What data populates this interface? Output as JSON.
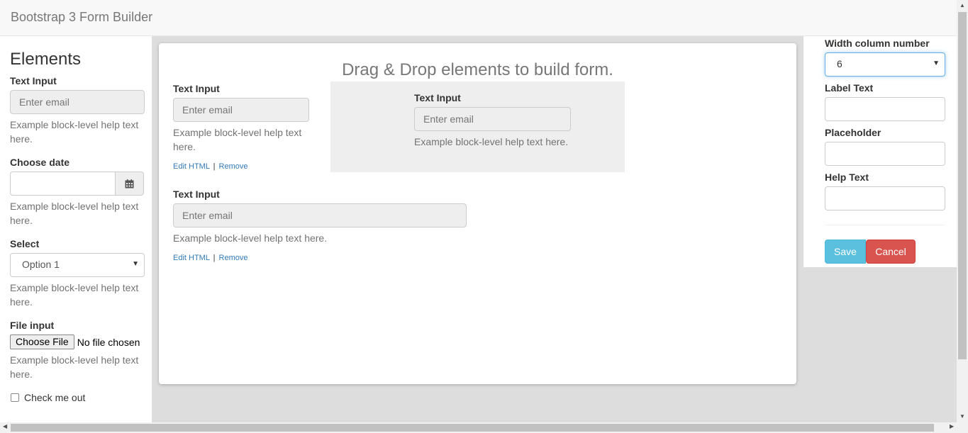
{
  "app": {
    "title": "Bootstrap 3 Form Builder"
  },
  "sidebar": {
    "heading": "Elements",
    "text_input": {
      "label": "Text Input",
      "placeholder": "Enter email",
      "help": "Example block-level help text here."
    },
    "date": {
      "label": "Choose date",
      "help": "Example block-level help text here.",
      "icon": "calendar-icon"
    },
    "select": {
      "label": "Select",
      "value": "Option 1",
      "help": "Example block-level help text here."
    },
    "file": {
      "label": "File input",
      "button": "Choose File",
      "status": "No file chosen",
      "help": "Example block-level help text here."
    },
    "checkbox": {
      "label": "Check me out"
    }
  },
  "canvas": {
    "title": "Drag & Drop elements to build form.",
    "fields": [
      {
        "label": "Text Input",
        "placeholder": "Enter email",
        "help": "Example block-level help text here.",
        "edit": "Edit HTML",
        "sep": "|",
        "remove": "Remove"
      },
      {
        "label": "Text Input",
        "placeholder": "Enter email",
        "help": "Example block-level help text here."
      },
      {
        "label": "Text Input",
        "placeholder": "Enter email",
        "help": "Example block-level help text here.",
        "edit": "Edit HTML",
        "sep": "|",
        "remove": "Remove"
      }
    ]
  },
  "properties": {
    "width_label": "Width column number",
    "width_value": "6",
    "label_text": "Label Text",
    "placeholder": "Placeholder",
    "help_text": "Help Text",
    "save": "Save",
    "cancel": "Cancel"
  },
  "colors": {
    "accent": "#5bc0de",
    "danger": "#d9534f",
    "link": "#337ab7"
  }
}
